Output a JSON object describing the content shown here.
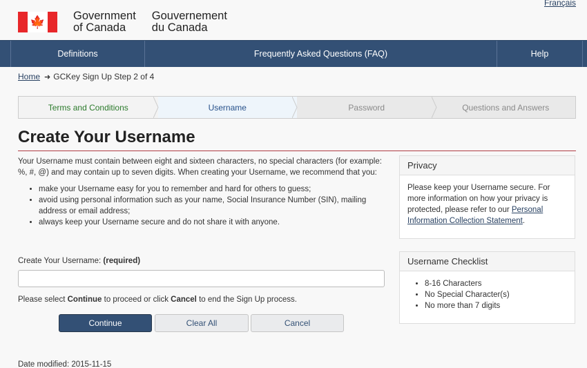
{
  "language_toggle": "Français",
  "header": {
    "gov_en_line1": "Government",
    "gov_en_line2": "of Canada",
    "gov_fr_line1": "Gouvernement",
    "gov_fr_line2": "du Canada"
  },
  "nav": {
    "items": [
      "Definitions",
      "Frequently Asked Questions (FAQ)",
      "Help"
    ]
  },
  "breadcrumb": {
    "home": "Home",
    "current": "GCKey Sign Up Step 2 of 4"
  },
  "steps": [
    "Terms and Conditions",
    "Username",
    "Password",
    "Questions and Answers"
  ],
  "page_title": "Create Your Username",
  "intro": {
    "paragraph": "Your Username must contain between eight and sixteen characters, no special characters (for example: %, #, @) and may contain up to seven digits. When creating your Username, we recommend that you:",
    "bullets": [
      "make your Username easy for you to remember and hard for others to guess;",
      "avoid using personal information such as your name, Social Insurance Number (SIN), mailing address or email address;",
      "always keep your Username secure and do not share it with anyone."
    ]
  },
  "form": {
    "label": "Create Your Username:",
    "required": "(required)",
    "value": "",
    "proceed_prefix": "Please select ",
    "proceed_continue": "Continue",
    "proceed_middle": " to proceed or click ",
    "proceed_cancel": "Cancel",
    "proceed_suffix": " to end the Sign Up process."
  },
  "buttons": {
    "continue": "Continue",
    "clear_all": "Clear All",
    "cancel": "Cancel"
  },
  "privacy": {
    "title": "Privacy",
    "text": "Please keep your Username secure. For more information on how your privacy is protected, please refer to our ",
    "link": "Personal Information Collection Statement",
    "end": "."
  },
  "checklist": {
    "title": "Username Checklist",
    "items": [
      "8-16 Characters",
      "No Special Character(s)",
      "No more than 7 digits"
    ]
  },
  "footer": {
    "modified": "Date modified: 2015-11-15"
  },
  "colors": {
    "nav_bg": "#335075",
    "flag_red": "#e8272a",
    "title_rule": "#af3c43",
    "step_done": "#2b7a2b"
  }
}
